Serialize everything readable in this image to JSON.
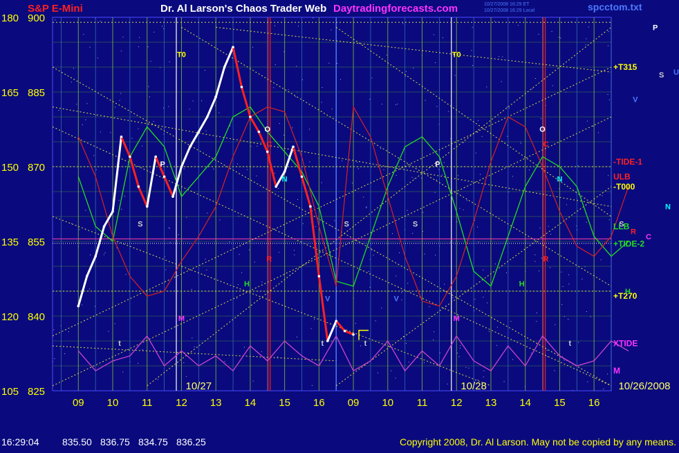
{
  "header": {
    "title_left": "S&P E-Mini",
    "title_center": "Dr. Al Larson's Chaos Trader Web",
    "website": "Daytradingforecasts.com",
    "file": "spcctom.txt",
    "stamp_line1": "10/27/2008 16:29 ET",
    "stamp_line2": "10/27/2008 16:29 Local"
  },
  "footer": {
    "time": "16:29:04",
    "open": "835.50",
    "high": "836.75",
    "low": "834.75",
    "close": "836.25",
    "copyright": "Copyright 2008, Dr. Al Larson. May not be copied by any means."
  },
  "colors": {
    "background": "#0a0a7e",
    "grid": "#3f7f3f",
    "price_white": "#ffffff",
    "price_red": "#ff2020",
    "green_curve": "#22dd22",
    "red_curve": "#dd2020",
    "xtide": "#cc44cc",
    "gann": "#dddd44",
    "axis_text": "#ffff00",
    "date_text": "#ffff66"
  },
  "chart_data": {
    "type": "line",
    "ylim": [
      825,
      900
    ],
    "y_ticks_price": [
      825,
      840,
      855,
      870,
      885,
      900
    ],
    "y_ticks_secondary": [
      105,
      120,
      135,
      150,
      165,
      180
    ],
    "x_hour_ticks": [
      "09",
      "10",
      "11",
      "12",
      "13",
      "14",
      "15",
      "16",
      "09",
      "10",
      "11",
      "12",
      "13",
      "14",
      "15",
      "16"
    ],
    "session_dates": [
      "10/27",
      "10/28",
      "10/26/2008"
    ],
    "series": [
      {
        "key": "price",
        "x": [
          0.0,
          0.25,
          0.5,
          0.75,
          1.0,
          1.25,
          1.5,
          1.75,
          2.0,
          2.25,
          2.5,
          2.75,
          3.0,
          3.25,
          3.5,
          3.75,
          4.0,
          4.25,
          4.5,
          4.75,
          5.0,
          5.25,
          5.5,
          5.75,
          6.0,
          6.25,
          6.5,
          6.75,
          7.0,
          7.25,
          7.5,
          7.75,
          8.0
        ],
        "values": [
          842,
          848,
          852,
          858,
          861,
          876,
          872,
          866,
          862,
          872,
          868,
          864,
          870,
          874,
          877,
          880,
          884,
          890,
          894,
          886,
          880,
          877,
          873,
          866,
          869,
          874,
          868,
          862,
          848,
          835,
          839,
          837,
          836.3
        ]
      },
      {
        "key": "green-curve",
        "x": [
          0,
          0.5,
          1.0,
          1.5,
          2.0,
          2.5,
          3.0,
          3.5,
          4.0,
          4.5,
          5.0,
          5.5,
          6.0,
          6.5,
          7.0,
          7.5,
          8.0,
          8.5,
          9.0,
          9.5,
          10.0,
          10.5,
          11.0,
          11.5,
          12.0,
          12.5,
          13.0,
          13.5,
          14.0,
          14.5,
          15.0,
          15.5,
          16.0
        ],
        "values": [
          868,
          858,
          855,
          872,
          878,
          874,
          864,
          868,
          872,
          880,
          882,
          877,
          873,
          869,
          862,
          847,
          846,
          856,
          866,
          874,
          876,
          872,
          861,
          849,
          846,
          856,
          866,
          872,
          870,
          866,
          856,
          852,
          855
        ]
      },
      {
        "key": "red-curve",
        "x": [
          0,
          0.5,
          1.0,
          1.5,
          2.0,
          2.5,
          3.0,
          3.5,
          4.0,
          4.5,
          5.0,
          5.5,
          6.0,
          6.5,
          7.0,
          7.5,
          8.0,
          8.5,
          9.0,
          9.5,
          10.0,
          10.5,
          11.0,
          11.5,
          12.0,
          12.5,
          13.0,
          13.5,
          14.0,
          14.5,
          15.0,
          15.5,
          16.0
        ],
        "values": [
          876,
          868,
          856,
          848,
          844,
          845,
          851,
          856,
          862,
          872,
          880,
          882,
          881,
          872,
          858,
          846,
          882,
          876,
          864,
          852,
          843,
          842,
          848,
          859,
          871,
          880,
          878,
          870,
          861,
          854,
          852,
          856,
          866
        ]
      },
      {
        "key": "xtide",
        "x": [
          0,
          0.5,
          1.0,
          1.5,
          2.0,
          2.5,
          3.0,
          3.5,
          4.0,
          4.5,
          5.0,
          5.5,
          6.0,
          6.5,
          7.0,
          7.5,
          8.0,
          8.5,
          9.0,
          9.5,
          10.0,
          10.5,
          11.0,
          11.5,
          12.0,
          12.5,
          13.0,
          13.5,
          14.0,
          14.5,
          15.0,
          15.5,
          16.0
        ],
        "values": [
          833,
          829,
          831,
          832,
          836,
          830,
          833,
          830,
          832,
          829,
          834,
          831,
          835,
          832,
          830,
          836,
          829,
          831,
          835,
          829,
          833,
          830,
          836,
          831,
          829,
          834,
          830,
          836,
          832,
          830,
          831,
          835,
          833
        ]
      }
    ],
    "line_labels": [
      {
        "text": "T0",
        "x": 3.0,
        "y": 892,
        "color": "#ffff00"
      },
      {
        "text": "T0",
        "x": 11.0,
        "y": 892,
        "color": "#ffff00"
      },
      {
        "text": "P",
        "x": 2.45,
        "y": 870,
        "color": "#ffffff"
      },
      {
        "text": "P",
        "x": 10.45,
        "y": 870,
        "color": "#ffffff"
      },
      {
        "text": "O",
        "x": 5.5,
        "y": 877,
        "color": "#ffffff"
      },
      {
        "text": "O",
        "x": 13.5,
        "y": 877,
        "color": "#ffffff"
      },
      {
        "text": "C",
        "x": 5.55,
        "y": 874,
        "color": "#ff2020"
      },
      {
        "text": "C",
        "x": 13.6,
        "y": 874,
        "color": "#ff2020"
      },
      {
        "text": "N",
        "x": 6.0,
        "y": 867,
        "color": "#00ffff"
      },
      {
        "text": "N",
        "x": 14.0,
        "y": 867,
        "color": "#00ffff"
      },
      {
        "text": "S",
        "x": 1.8,
        "y": 858,
        "color": "#cccccc"
      },
      {
        "text": "S",
        "x": 7.8,
        "y": 858,
        "color": "#cccccc"
      },
      {
        "text": "S",
        "x": 9.8,
        "y": 858,
        "color": "#cccccc"
      },
      {
        "text": "S",
        "x": 15.8,
        "y": 858,
        "color": "#cccccc"
      },
      {
        "text": "R",
        "x": 5.55,
        "y": 851,
        "color": "#ff2020"
      },
      {
        "text": "R",
        "x": 13.6,
        "y": 851,
        "color": "#ff2020"
      },
      {
        "text": "H",
        "x": 4.9,
        "y": 846,
        "color": "#22dd22"
      },
      {
        "text": "H",
        "x": 12.9,
        "y": 846,
        "color": "#22dd22"
      },
      {
        "text": "V",
        "x": 7.25,
        "y": 843,
        "color": "#4d79ff"
      },
      {
        "text": "V",
        "x": 9.25,
        "y": 843,
        "color": "#4d79ff"
      },
      {
        "text": "M",
        "x": 3.0,
        "y": 839,
        "color": "#ff33ff"
      },
      {
        "text": "M",
        "x": 11.0,
        "y": 839,
        "color": "#ff33ff"
      },
      {
        "text": "t",
        "x": 1.2,
        "y": 834,
        "color": "#cccccc"
      },
      {
        "text": "t",
        "x": 7.1,
        "y": 834,
        "color": "#cccccc"
      },
      {
        "text": "t",
        "x": 8.35,
        "y": 834,
        "color": "#cccccc"
      },
      {
        "text": "t",
        "x": 14.3,
        "y": 834,
        "color": "#cccccc"
      },
      {
        "text": "V",
        "x": 16.2,
        "y": 883,
        "color": "#4d79ff"
      }
    ],
    "right_labels": [
      {
        "text": "+T315",
        "y": 890,
        "color": "#ffff00"
      },
      {
        "text": "-TIDE-1",
        "y": 871,
        "color": "#ff2020"
      },
      {
        "text": "ULB",
        "y": 868,
        "color": "#ff2020"
      },
      {
        "text": "-T000",
        "y": 866,
        "color": "#ffff00"
      },
      {
        "text": "LLB",
        "y": 858,
        "color": "#22dd22"
      },
      {
        "text": "+TIDE-2",
        "y": 854.5,
        "color": "#22dd22"
      },
      {
        "text": "+T270",
        "y": 844,
        "color": "#ffff00"
      },
      {
        "text": "XTIDE",
        "y": 834.5,
        "color": "#ff33ff"
      },
      {
        "text": "M",
        "y": 829,
        "color": "#ff33ff"
      }
    ],
    "far_right_letters": [
      {
        "text": "P",
        "y": 898,
        "color": "#ffffff"
      },
      {
        "text": "S",
        "y": 888.5,
        "color": "#cccccc"
      },
      {
        "text": "U",
        "y": 889,
        "color": "#4d79ff"
      },
      {
        "text": "N",
        "y": 862,
        "color": "#00ffff"
      },
      {
        "text": "R",
        "y": 857,
        "color": "#ff2020"
      },
      {
        "text": "C",
        "y": 856,
        "color": "#ff33ff"
      },
      {
        "text": "H",
        "y": 845,
        "color": "#22dd22"
      }
    ]
  }
}
